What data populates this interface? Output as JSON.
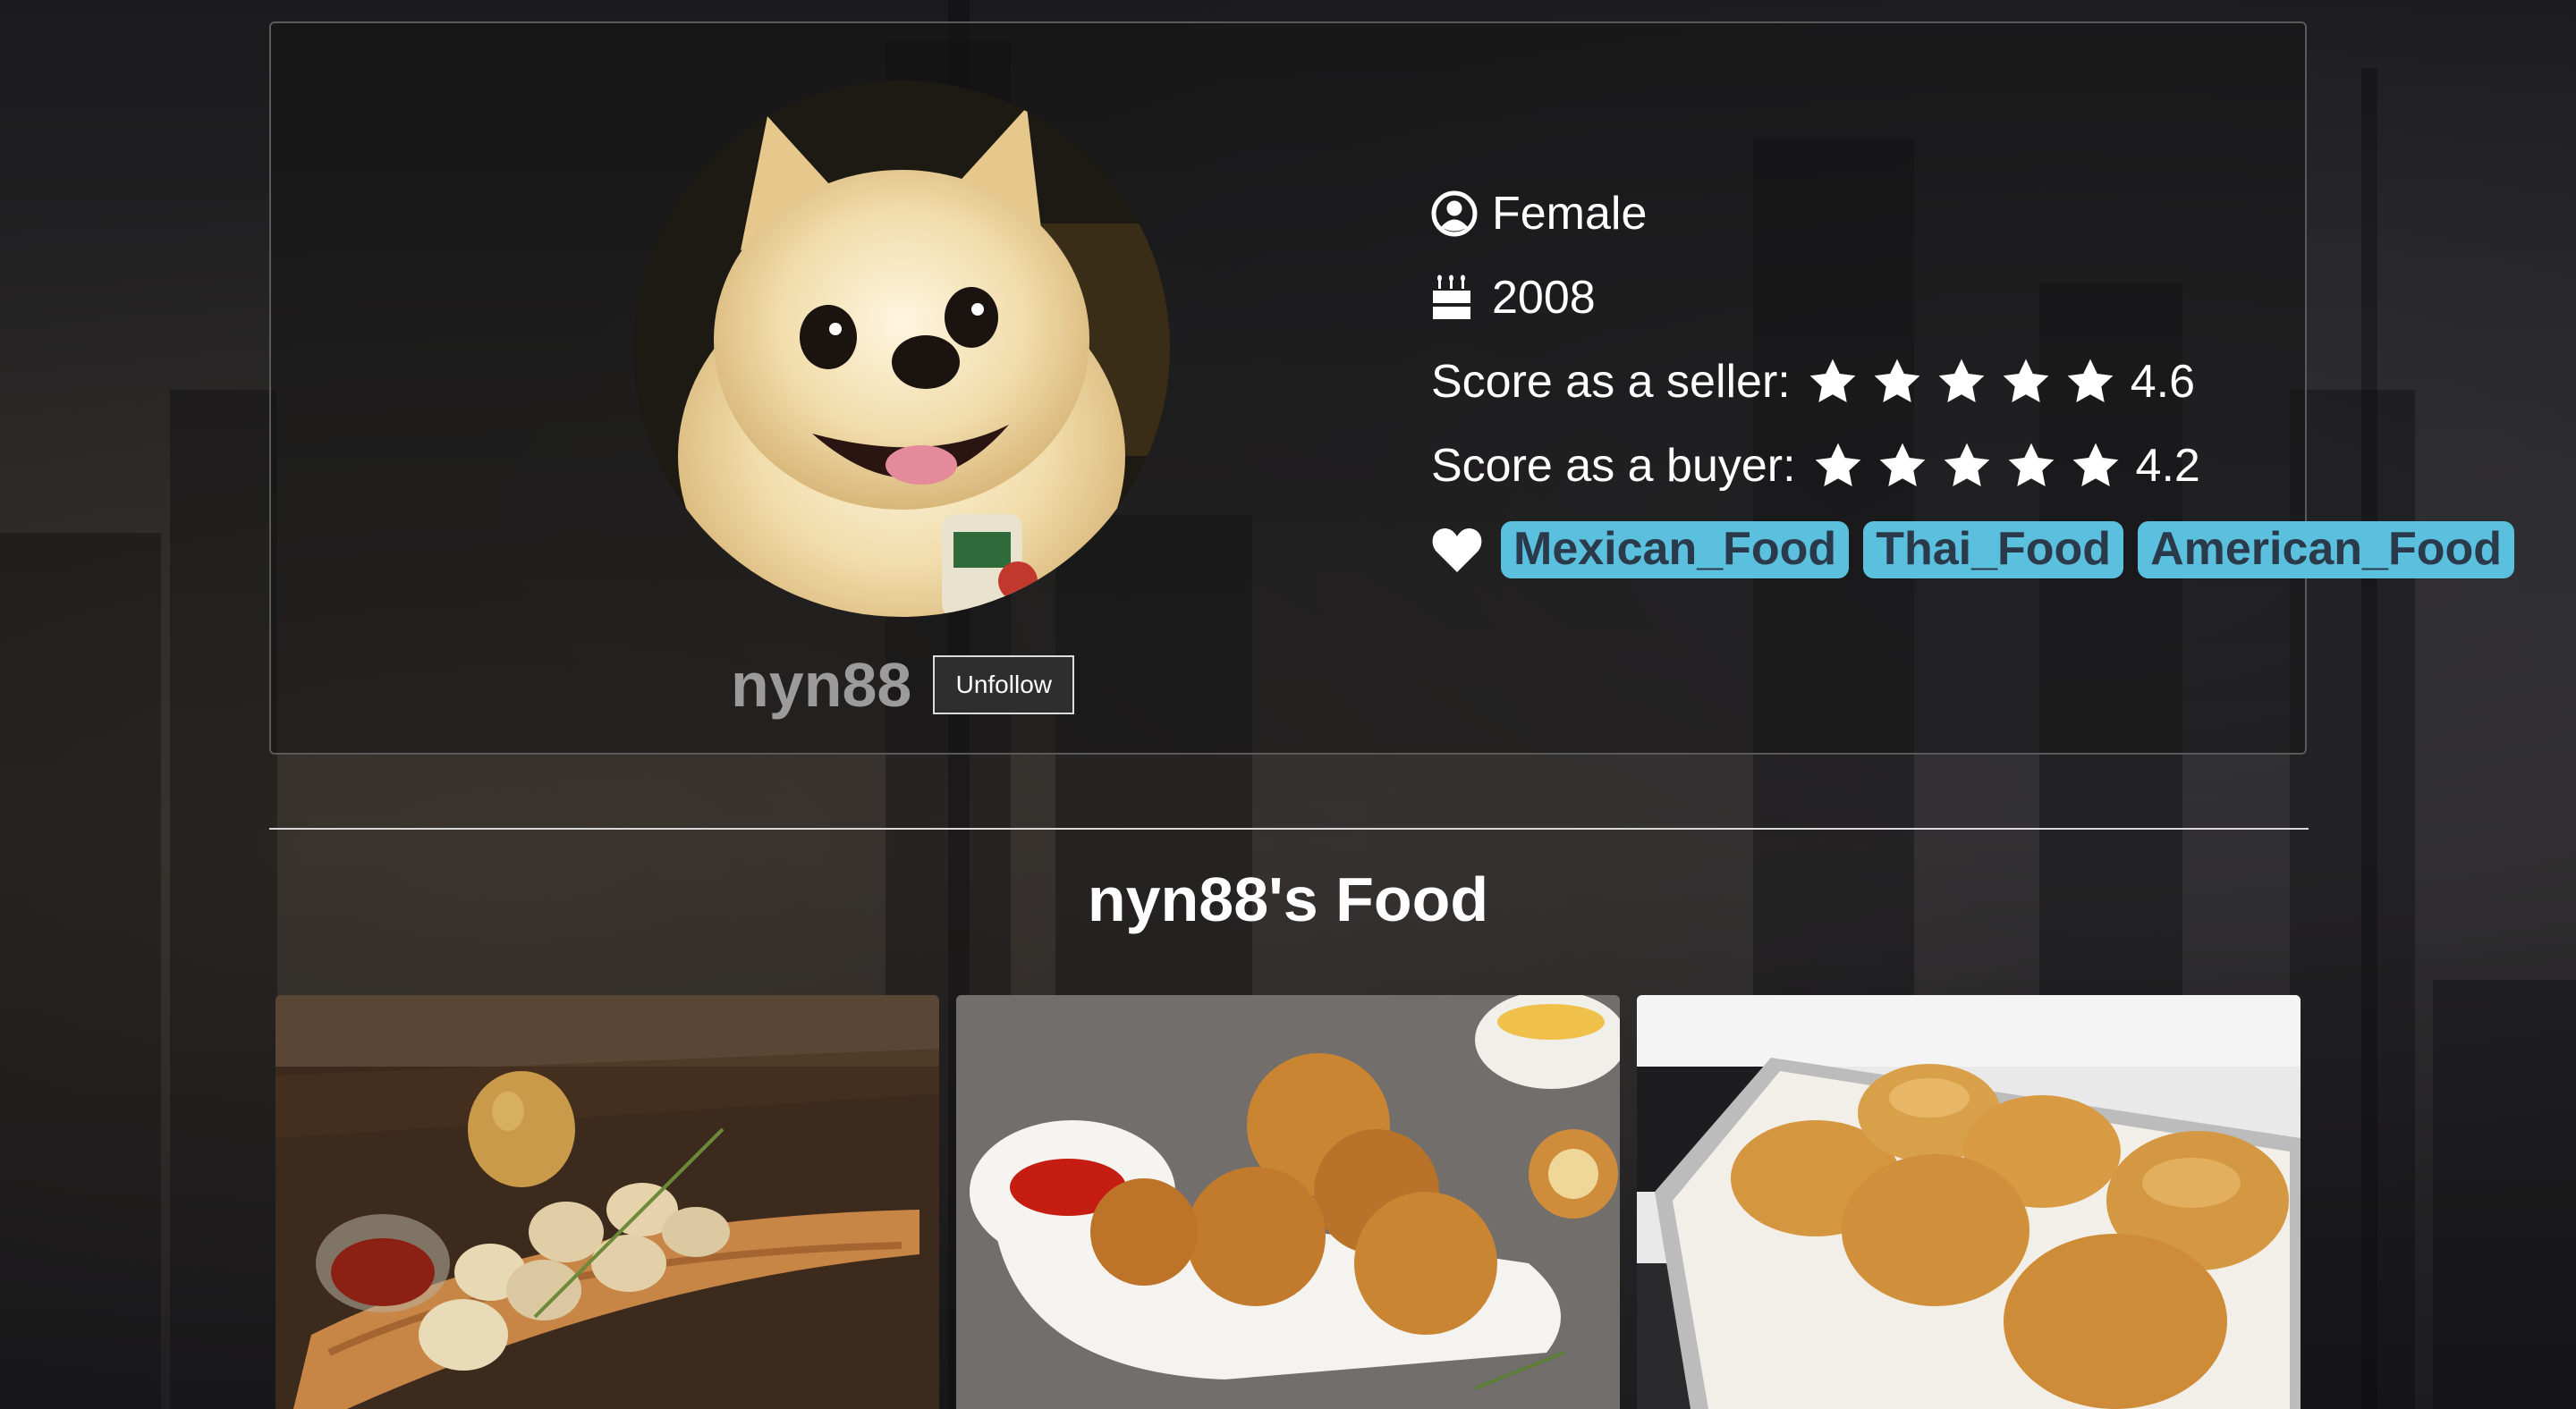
{
  "profile": {
    "username": "nyn88",
    "follow_button_label": "Unfollow",
    "gender": "Female",
    "birth_year": "2008",
    "seller_label": "Score as a seller:",
    "seller_score": "4.6",
    "seller_rating": 4.6,
    "buyer_label": "Score as a buyer:",
    "buyer_score": "4.2",
    "buyer_rating": 4.2,
    "favorite_tags": [
      "Mexican_Food",
      "Thai_Food",
      "American_Food"
    ],
    "tag_color": "#5bc0de"
  },
  "food_section": {
    "title": "nyn88's Food",
    "items": [
      {
        "icon": "dumplings-photo"
      },
      {
        "icon": "croquettes-photo"
      },
      {
        "icon": "bread-rolls-photo"
      }
    ]
  }
}
